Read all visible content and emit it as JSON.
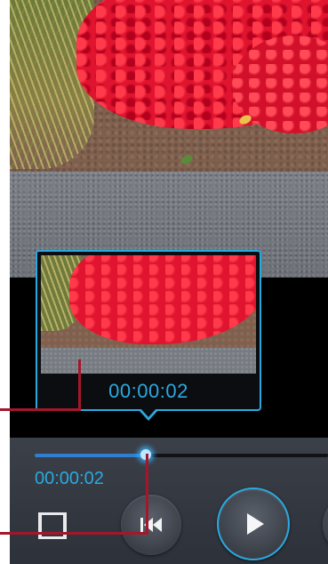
{
  "preview": {
    "timestamp": "00:00:02"
  },
  "player": {
    "elapsed": "00:00:02",
    "progress_fraction": 0.38
  },
  "controls": {
    "aspect_icon": "aspect-ratio-icon",
    "previous_icon": "skip-previous-icon",
    "play_icon": "play-icon"
  },
  "colors": {
    "accent": "#2aa9e0",
    "progress": "#2f7fd0",
    "callout": "#a3172b",
    "panel": "#3b4049"
  }
}
